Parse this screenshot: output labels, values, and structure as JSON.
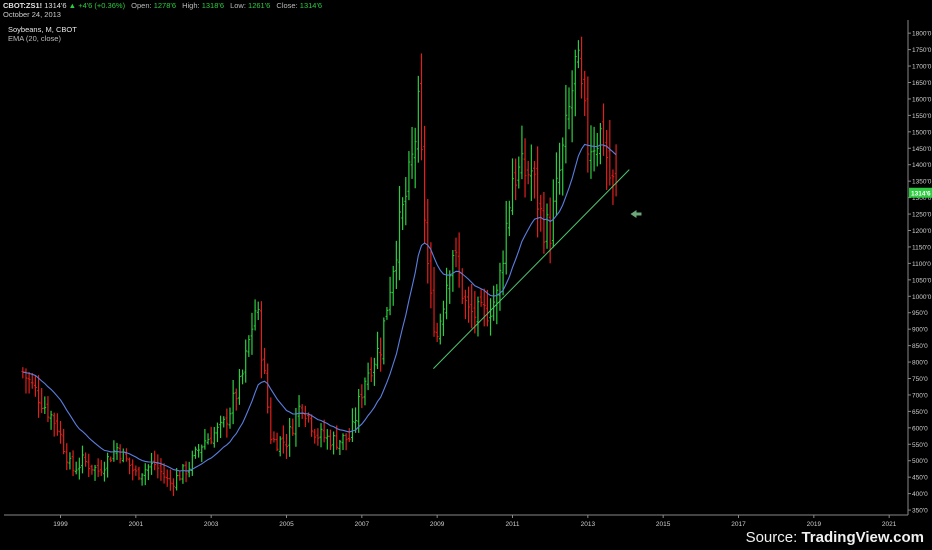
{
  "header": {
    "symbol": "CBOT:ZS1!",
    "last": "1314'6",
    "change": "+4'6 (+0.36%)",
    "open_label": "Open:",
    "open": "1278'6",
    "high_label": "High:",
    "high": "1318'6",
    "low_label": "Low:",
    "low": "1261'6",
    "close_label": "Close:",
    "close": "1314'6",
    "date": "October 24, 2013"
  },
  "source": {
    "prefix": "Source: ",
    "brand": "TradingView.com"
  },
  "colors": {
    "up": "#2ecc40",
    "down": "#e0201a",
    "ema": "#5b7fe0",
    "trendline": "#4cc870",
    "axis": "#888888",
    "price_tag": "#2ecc40"
  },
  "chart_data": {
    "type": "ohlc",
    "title": "Soybeans, M, CBOT",
    "indicator": "EMA (20, close)",
    "xlim": [
      1997.5,
      2021.5
    ],
    "ylim": [
      335,
      1840
    ],
    "x_ticks": [
      "1999",
      "2001",
      "2003",
      "2005",
      "2007",
      "2009",
      "2011",
      "2013",
      "2015",
      "2017",
      "2019",
      "2021"
    ],
    "y_ticks": [
      "350'0",
      "400'0",
      "450'0",
      "500'0",
      "550'0",
      "600'0",
      "650'0",
      "700'0",
      "750'0",
      "800'0",
      "850'0",
      "900'0",
      "950'0",
      "1000'0",
      "1050'0",
      "1100'0",
      "1150'0",
      "1200'0",
      "1250'0",
      "1300'0",
      "1350'0",
      "1400'0",
      "1450'0",
      "1500'0",
      "1550'0",
      "1600'0",
      "1650'0",
      "1700'0",
      "1750'0",
      "1800'0"
    ],
    "current_price": 1314.75,
    "current_price_label": "1314'6",
    "grid": false,
    "trendline": {
      "x": [
        2008.9,
        2014.1
      ],
      "y": [
        780,
        1385
      ]
    },
    "anchors": [
      {
        "t": 1998.0,
        "p": 770
      },
      {
        "t": 1998.4,
        "p": 700
      },
      {
        "t": 1998.9,
        "p": 610
      },
      {
        "t": 1999.3,
        "p": 470
      },
      {
        "t": 1999.6,
        "p": 500
      },
      {
        "t": 2000.0,
        "p": 470
      },
      {
        "t": 2000.5,
        "p": 540
      },
      {
        "t": 2001.0,
        "p": 460
      },
      {
        "t": 2001.5,
        "p": 490
      },
      {
        "t": 2001.9,
        "p": 430
      },
      {
        "t": 2002.4,
        "p": 480
      },
      {
        "t": 2002.8,
        "p": 560
      },
      {
        "t": 2003.3,
        "p": 600
      },
      {
        "t": 2003.8,
        "p": 740
      },
      {
        "t": 2004.2,
        "p": 980
      },
      {
        "t": 2004.6,
        "p": 560
      },
      {
        "t": 2005.0,
        "p": 560
      },
      {
        "t": 2005.4,
        "p": 680
      },
      {
        "t": 2005.8,
        "p": 580
      },
      {
        "t": 2006.3,
        "p": 560
      },
      {
        "t": 2006.7,
        "p": 570
      },
      {
        "t": 2007.1,
        "p": 760
      },
      {
        "t": 2007.5,
        "p": 850
      },
      {
        "t": 2007.9,
        "p": 1150
      },
      {
        "t": 2008.3,
        "p": 1380
      },
      {
        "t": 2008.5,
        "p": 1560
      },
      {
        "t": 2008.8,
        "p": 1000
      },
      {
        "t": 2009.0,
        "p": 880
      },
      {
        "t": 2009.4,
        "p": 1150
      },
      {
        "t": 2009.8,
        "p": 950
      },
      {
        "t": 2010.2,
        "p": 940
      },
      {
        "t": 2010.6,
        "p": 1000
      },
      {
        "t": 2011.0,
        "p": 1370
      },
      {
        "t": 2011.5,
        "p": 1380
      },
      {
        "t": 2011.8,
        "p": 1220
      },
      {
        "t": 2012.0,
        "p": 1200
      },
      {
        "t": 2012.4,
        "p": 1480
      },
      {
        "t": 2012.7,
        "p": 1720
      },
      {
        "t": 2013.0,
        "p": 1460
      },
      {
        "t": 2013.4,
        "p": 1500
      },
      {
        "t": 2013.6,
        "p": 1350
      },
      {
        "t": 2013.83,
        "p": 1310
      }
    ]
  }
}
